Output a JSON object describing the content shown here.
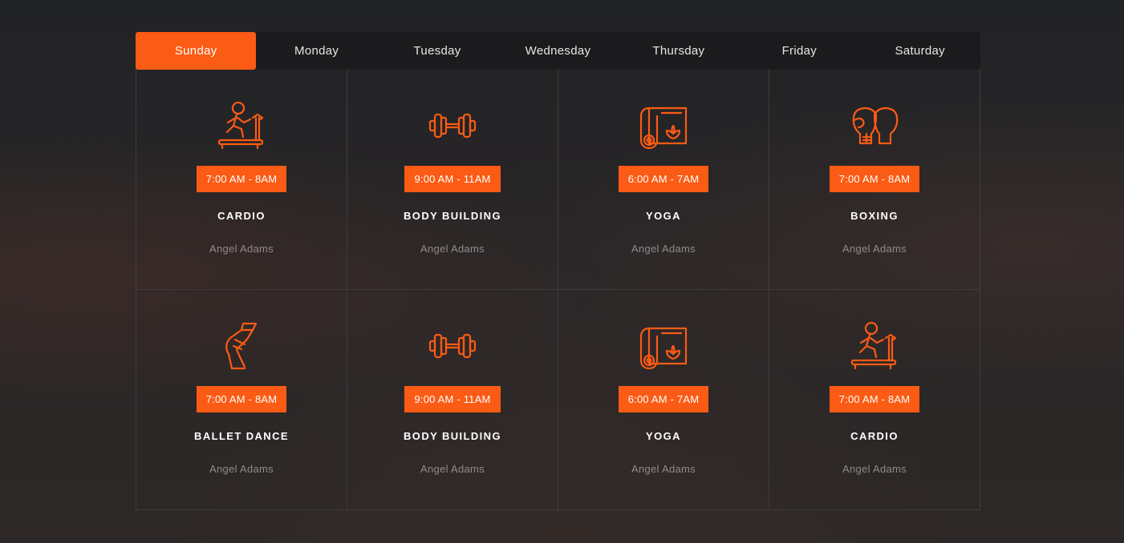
{
  "tabs": [
    {
      "label": "Sunday",
      "active": true
    },
    {
      "label": "Monday",
      "active": false
    },
    {
      "label": "Tuesday",
      "active": false
    },
    {
      "label": "Wednesday",
      "active": false
    },
    {
      "label": "Thursday",
      "active": false
    },
    {
      "label": "Friday",
      "active": false
    },
    {
      "label": "Saturday",
      "active": false
    }
  ],
  "classes": [
    {
      "icon": "treadmill-icon",
      "time": "7:00 AM - 8AM",
      "name": "CARDIO",
      "trainer": "Angel Adams"
    },
    {
      "icon": "dumbbell-icon",
      "time": "9:00 AM - 11AM",
      "name": "BODY BUILDING",
      "trainer": "Angel Adams"
    },
    {
      "icon": "yoga-mat-icon",
      "time": "6:00 AM - 7AM",
      "name": "YOGA",
      "trainer": "Angel Adams"
    },
    {
      "icon": "boxing-gloves-icon",
      "time": "7:00 AM - 8AM",
      "name": "BOXING",
      "trainer": "Angel Adams"
    },
    {
      "icon": "ballet-shoe-icon",
      "time": "7:00 AM - 8AM",
      "name": "BALLET DANCE",
      "trainer": "Angel Adams"
    },
    {
      "icon": "dumbbell-icon",
      "time": "9:00 AM - 11AM",
      "name": "BODY BUILDING",
      "trainer": "Angel Adams"
    },
    {
      "icon": "yoga-mat-icon",
      "time": "6:00 AM - 7AM",
      "name": "YOGA",
      "trainer": "Angel Adams"
    },
    {
      "icon": "treadmill-icon",
      "time": "7:00 AM - 8AM",
      "name": "CARDIO",
      "trainer": "Angel Adams"
    }
  ],
  "colors": {
    "accent": "#fb5b14",
    "tab_bar": "#1b1b1d",
    "text": "#ffffff",
    "muted": "#8f8c8c"
  }
}
